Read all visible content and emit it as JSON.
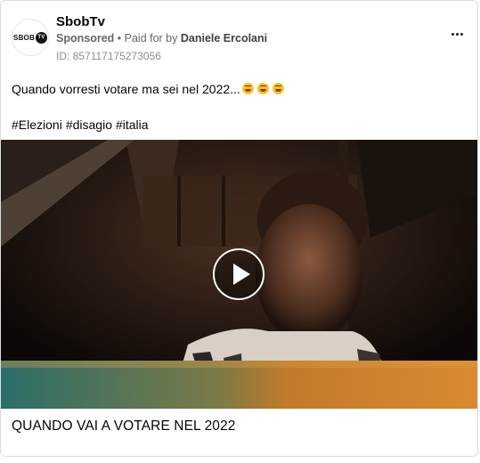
{
  "post": {
    "page_name": "SbobTv",
    "avatar_text": "SBOB",
    "avatar_badge": "TV",
    "sponsored_label": "Sponsored",
    "separator": " • ",
    "paid_for_prefix": "Paid for by ",
    "advertiser": "Daniele Ercolani",
    "ad_id": "ID: 857117175273056",
    "more_icon": "more-horizontal-icon",
    "caption": "Quando vorresti votare ma sei nel 2022...",
    "caption_emoji_icon": "grinning-sweat-emoji-icon",
    "hashtags": [
      "#Elezioni",
      "#disagio",
      "#italia"
    ],
    "media_play_icon": "play-icon",
    "link_title": "QUANDO VAI A VOTARE NEL 2022"
  }
}
